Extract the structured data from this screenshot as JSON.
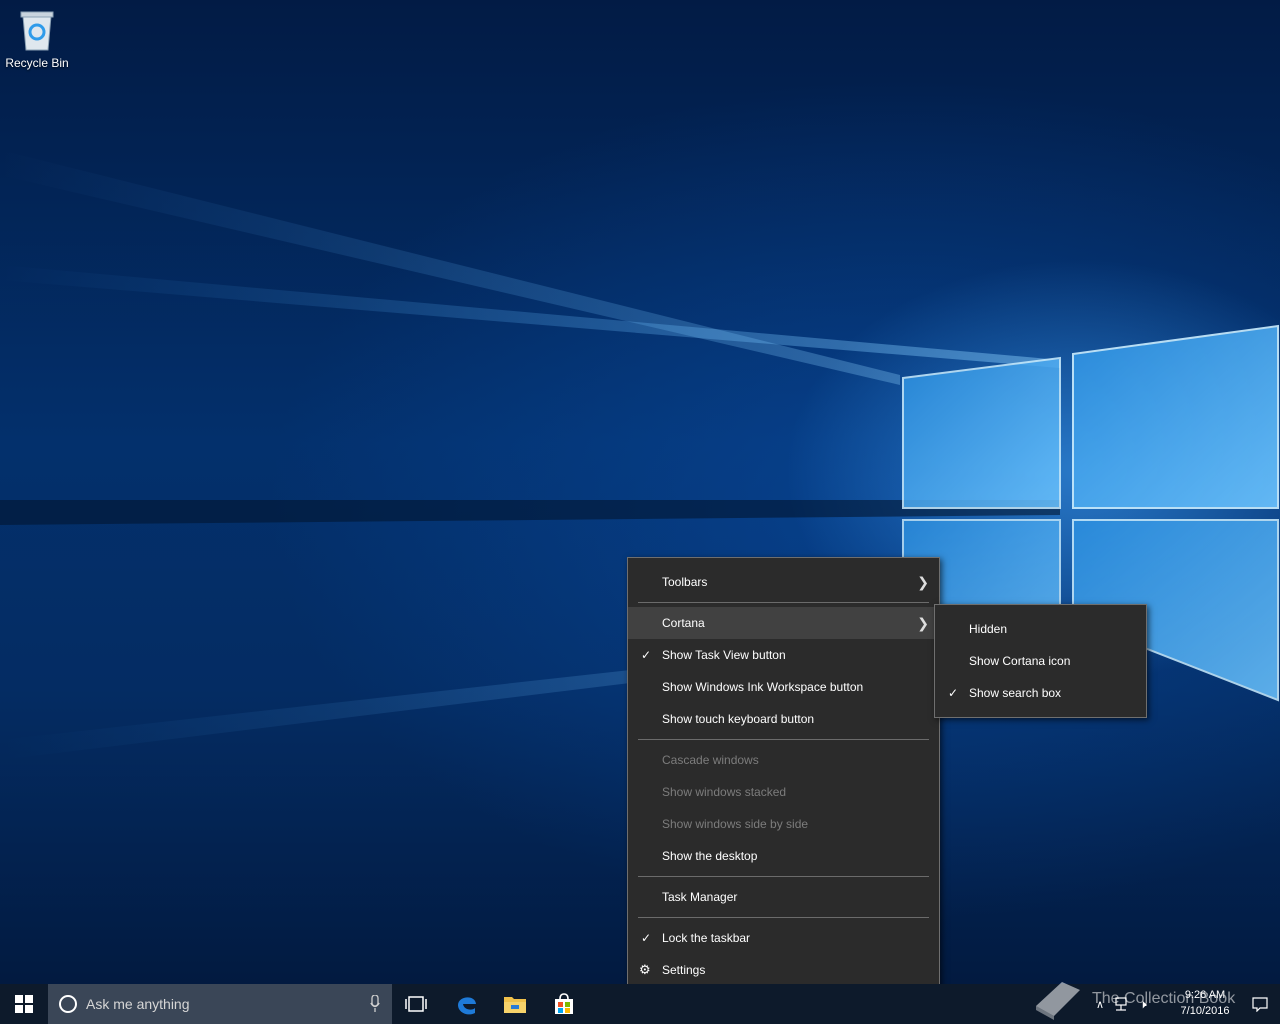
{
  "desktop": {
    "icons": [
      {
        "label": "Recycle Bin",
        "icon": "recycle-bin-icon"
      }
    ]
  },
  "context_menu": {
    "items": {
      "toolbars": "Toolbars",
      "cortana": "Cortana",
      "show_task_view": "Show Task View button",
      "show_ink_workspace": "Show Windows Ink Workspace button",
      "show_touch_keyboard": "Show touch keyboard button",
      "cascade": "Cascade windows",
      "stacked": "Show windows stacked",
      "side_by_side": "Show windows side by side",
      "show_desktop": "Show the desktop",
      "task_manager": "Task Manager",
      "lock_taskbar": "Lock the taskbar",
      "settings": "Settings"
    },
    "checked": [
      "Show Task View button",
      "Lock the taskbar"
    ],
    "disabled": [
      "Cascade windows",
      "Show windows stacked",
      "Show windows side by side"
    ],
    "highlighted": "Cortana"
  },
  "cortana_submenu": {
    "items": {
      "hidden": "Hidden",
      "show_icon": "Show Cortana icon",
      "show_search_box": "Show search box"
    },
    "checked": "Show search box"
  },
  "taskbar": {
    "search_placeholder": "Ask me anything",
    "pinned": [
      "task-view-icon",
      "edge-icon",
      "file-explorer-icon",
      "store-icon"
    ],
    "clock": {
      "time": "9:26 AM",
      "date": "7/10/2016"
    }
  },
  "watermark": {
    "text": "The Collection Book"
  },
  "colors": {
    "menu_bg": "#2b2b2b",
    "menu_hover": "#414141",
    "taskbar": "#0d1a2b",
    "search_box": "#3a4657"
  }
}
